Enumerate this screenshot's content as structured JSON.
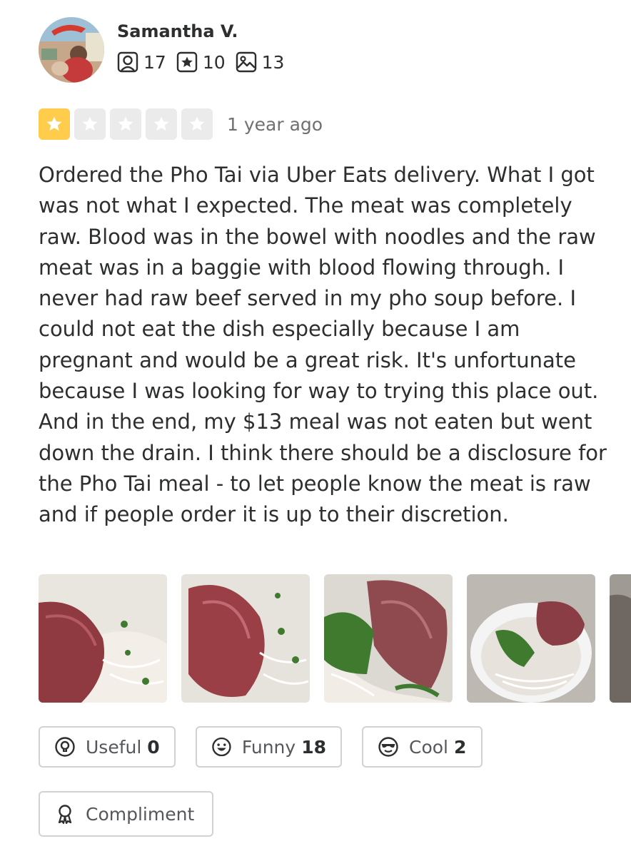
{
  "user": {
    "name": "Samantha V.",
    "stats": {
      "friends": "17",
      "reviews": "10",
      "photos": "13"
    }
  },
  "review": {
    "rating": 1,
    "rating_max": 5,
    "date": "1 year ago",
    "text": "Ordered the Pho Tai via Uber Eats delivery. What I got was not what I expected. The meat was completely raw. Blood was in the bowel with noodles and the raw meat was in a baggie with blood flowing through. I never had raw beef served in my pho soup before. I could not eat the dish especially because I am pregnant and would be a great risk. It's unfortunate because I was looking for way to trying this place out. And in the end, my $13 meal was not eaten but went down the drain. I think there should be a disclosure for the Pho Tai meal - to let people know the meat is raw and if people order it is up to their discretion."
  },
  "photos": [
    "pho-photo-1",
    "pho-photo-2",
    "pho-photo-3",
    "pho-photo-4",
    "pho-photo-5"
  ],
  "reactions": {
    "useful": {
      "label": "Useful",
      "count": "0"
    },
    "funny": {
      "label": "Funny",
      "count": "18"
    },
    "cool": {
      "label": "Cool",
      "count": "2"
    }
  },
  "compliment_label": "Compliment",
  "colors": {
    "star_active": "#ffcc4b",
    "star_inactive": "#ebebeb",
    "text": "#2d2e2f",
    "muted": "#6e7072",
    "border": "#d2d2d2"
  },
  "icons": [
    "friends-icon",
    "review-count-icon",
    "photo-count-icon",
    "star-icon",
    "useful-icon",
    "funny-icon",
    "cool-icon",
    "compliment-icon"
  ]
}
